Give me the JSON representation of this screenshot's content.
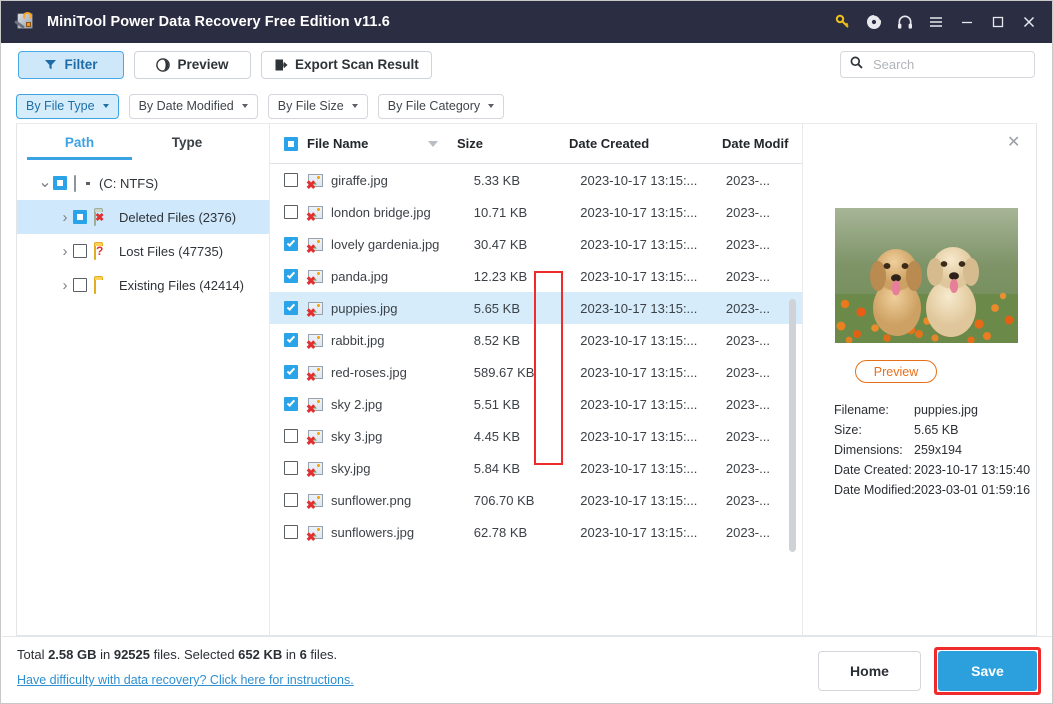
{
  "window": {
    "title": "MiniTool Power Data Recovery Free Edition v11.6",
    "icons": {
      "key": "key-icon",
      "disc": "disc-icon",
      "headphones": "headphones-icon",
      "menu": "hamburger-menu-icon",
      "minimize": "minimize-icon",
      "maximize": "maximize-icon",
      "close": "close-icon"
    },
    "accent": "#2b2d42"
  },
  "toolbar": {
    "filter_label": "Filter",
    "preview_label": "Preview",
    "export_label": "Export Scan Result",
    "search_placeholder": "Search",
    "search_value": ""
  },
  "filterbar": {
    "buttons": [
      {
        "label": "By File Type",
        "active": true
      },
      {
        "label": "By Date Modified",
        "active": false
      },
      {
        "label": "By File Size",
        "active": false
      },
      {
        "label": "By File Category",
        "active": false
      }
    ]
  },
  "tree": {
    "tabs": [
      {
        "label": "Path",
        "active": true
      },
      {
        "label": "Type",
        "active": false
      }
    ],
    "nodes": [
      {
        "label": "(C: NTFS)",
        "check": "partial",
        "icon": "drive-icon",
        "expanded": true,
        "selected": false,
        "level": 0
      },
      {
        "label": "Deleted Files (2376)",
        "check": "partial",
        "icon": "folder-deleted-icon",
        "expanded": false,
        "selected": true,
        "level": 1
      },
      {
        "label": "Lost Files (47735)",
        "check": "unchecked",
        "icon": "folder-lost-icon",
        "expanded": false,
        "selected": false,
        "level": 1
      },
      {
        "label": "Existing Files (42414)",
        "check": "unchecked",
        "icon": "folder-icon",
        "expanded": false,
        "selected": false,
        "level": 1
      }
    ]
  },
  "filelist": {
    "header_checkbox": "partial",
    "columns": [
      "File Name",
      "Size",
      "Date Created",
      "Date Modif"
    ],
    "sort_column": "File Name",
    "sort_direction": "descending",
    "rows": [
      {
        "name": "giraffe.jpg",
        "size": "5.33 KB",
        "created": "2023-10-17 13:15:...",
        "modified": "2023-...",
        "checked": false,
        "selected": false
      },
      {
        "name": "london bridge.jpg",
        "size": "10.71 KB",
        "created": "2023-10-17 13:15:...",
        "modified": "2023-...",
        "checked": false,
        "selected": false
      },
      {
        "name": "lovely gardenia.jpg",
        "size": "30.47 KB",
        "created": "2023-10-17 13:15:...",
        "modified": "2023-...",
        "checked": true,
        "selected": false
      },
      {
        "name": "panda.jpg",
        "size": "12.23 KB",
        "created": "2023-10-17 13:15:...",
        "modified": "2023-...",
        "checked": true,
        "selected": false
      },
      {
        "name": "puppies.jpg",
        "size": "5.65 KB",
        "created": "2023-10-17 13:15:...",
        "modified": "2023-...",
        "checked": true,
        "selected": true
      },
      {
        "name": "rabbit.jpg",
        "size": "8.52 KB",
        "created": "2023-10-17 13:15:...",
        "modified": "2023-...",
        "checked": true,
        "selected": false
      },
      {
        "name": "red-roses.jpg",
        "size": "589.67 KB",
        "created": "2023-10-17 13:15:...",
        "modified": "2023-...",
        "checked": true,
        "selected": false
      },
      {
        "name": "sky 2.jpg",
        "size": "5.51 KB",
        "created": "2023-10-17 13:15:...",
        "modified": "2023-...",
        "checked": true,
        "selected": false
      },
      {
        "name": "sky 3.jpg",
        "size": "4.45 KB",
        "created": "2023-10-17 13:15:...",
        "modified": "2023-...",
        "checked": false,
        "selected": false
      },
      {
        "name": "sky.jpg",
        "size": "5.84 KB",
        "created": "2023-10-17 13:15:...",
        "modified": "2023-...",
        "checked": false,
        "selected": false
      },
      {
        "name": "sunflower.png",
        "size": "706.70 KB",
        "created": "2023-10-17 13:15:...",
        "modified": "2023-...",
        "checked": false,
        "selected": false
      },
      {
        "name": "sunflowers.jpg",
        "size": "62.78 KB",
        "created": "2023-10-17 13:15:...",
        "modified": "2023-...",
        "checked": false,
        "selected": false
      }
    ]
  },
  "preview": {
    "close_icon": "close-icon",
    "image_alt": "two golden retriever puppies in orange flower field",
    "preview_button": "Preview",
    "details": [
      {
        "key": "Filename:",
        "value": "puppies.jpg"
      },
      {
        "key": "Size:",
        "value": "5.65 KB"
      },
      {
        "key": "Dimensions:",
        "value": "259x194"
      },
      {
        "key": "Date Created:",
        "value": "2023-10-17 13:15:40"
      },
      {
        "key": "Date Modified:",
        "value": "2023-03-01 01:59:16"
      }
    ]
  },
  "status": {
    "total_prefix": "Total ",
    "total_size": "2.58 GB",
    "total_mid": " in ",
    "total_count": "92525",
    "total_suffix": " files.  Selected ",
    "selected_size": "652 KB",
    "selected_mid": " in ",
    "selected_count": "6",
    "selected_suffix": " files.",
    "help_link": "Have difficulty with data recovery? Click here for instructions.",
    "home_label": "Home",
    "save_label": "Save",
    "save_color": "#2ba0dd",
    "highlight_color": "#ef2b2b"
  }
}
